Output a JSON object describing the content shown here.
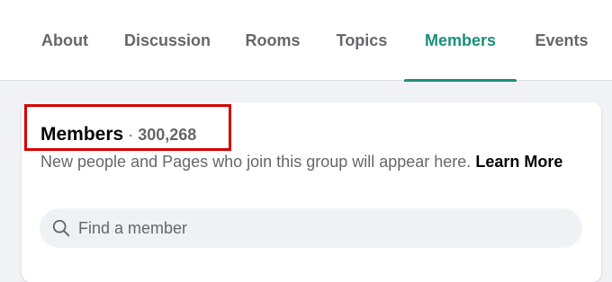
{
  "tabs": [
    {
      "label": "About",
      "active": false
    },
    {
      "label": "Discussion",
      "active": false
    },
    {
      "label": "Rooms",
      "active": false
    },
    {
      "label": "Topics",
      "active": false
    },
    {
      "label": "Members",
      "active": true
    },
    {
      "label": "Events",
      "active": false
    }
  ],
  "members_section": {
    "title": "Members",
    "separator": "·",
    "count": "300,268",
    "description": "New people and Pages who join this group will appear here.",
    "learn_more": "Learn More"
  },
  "search": {
    "icon": "search-icon",
    "placeholder": "Find a member",
    "value": ""
  },
  "colors": {
    "accent": "#1b8f78",
    "highlight_box": "#d40000",
    "muted_text": "#65676b",
    "primary_text": "#050505"
  }
}
